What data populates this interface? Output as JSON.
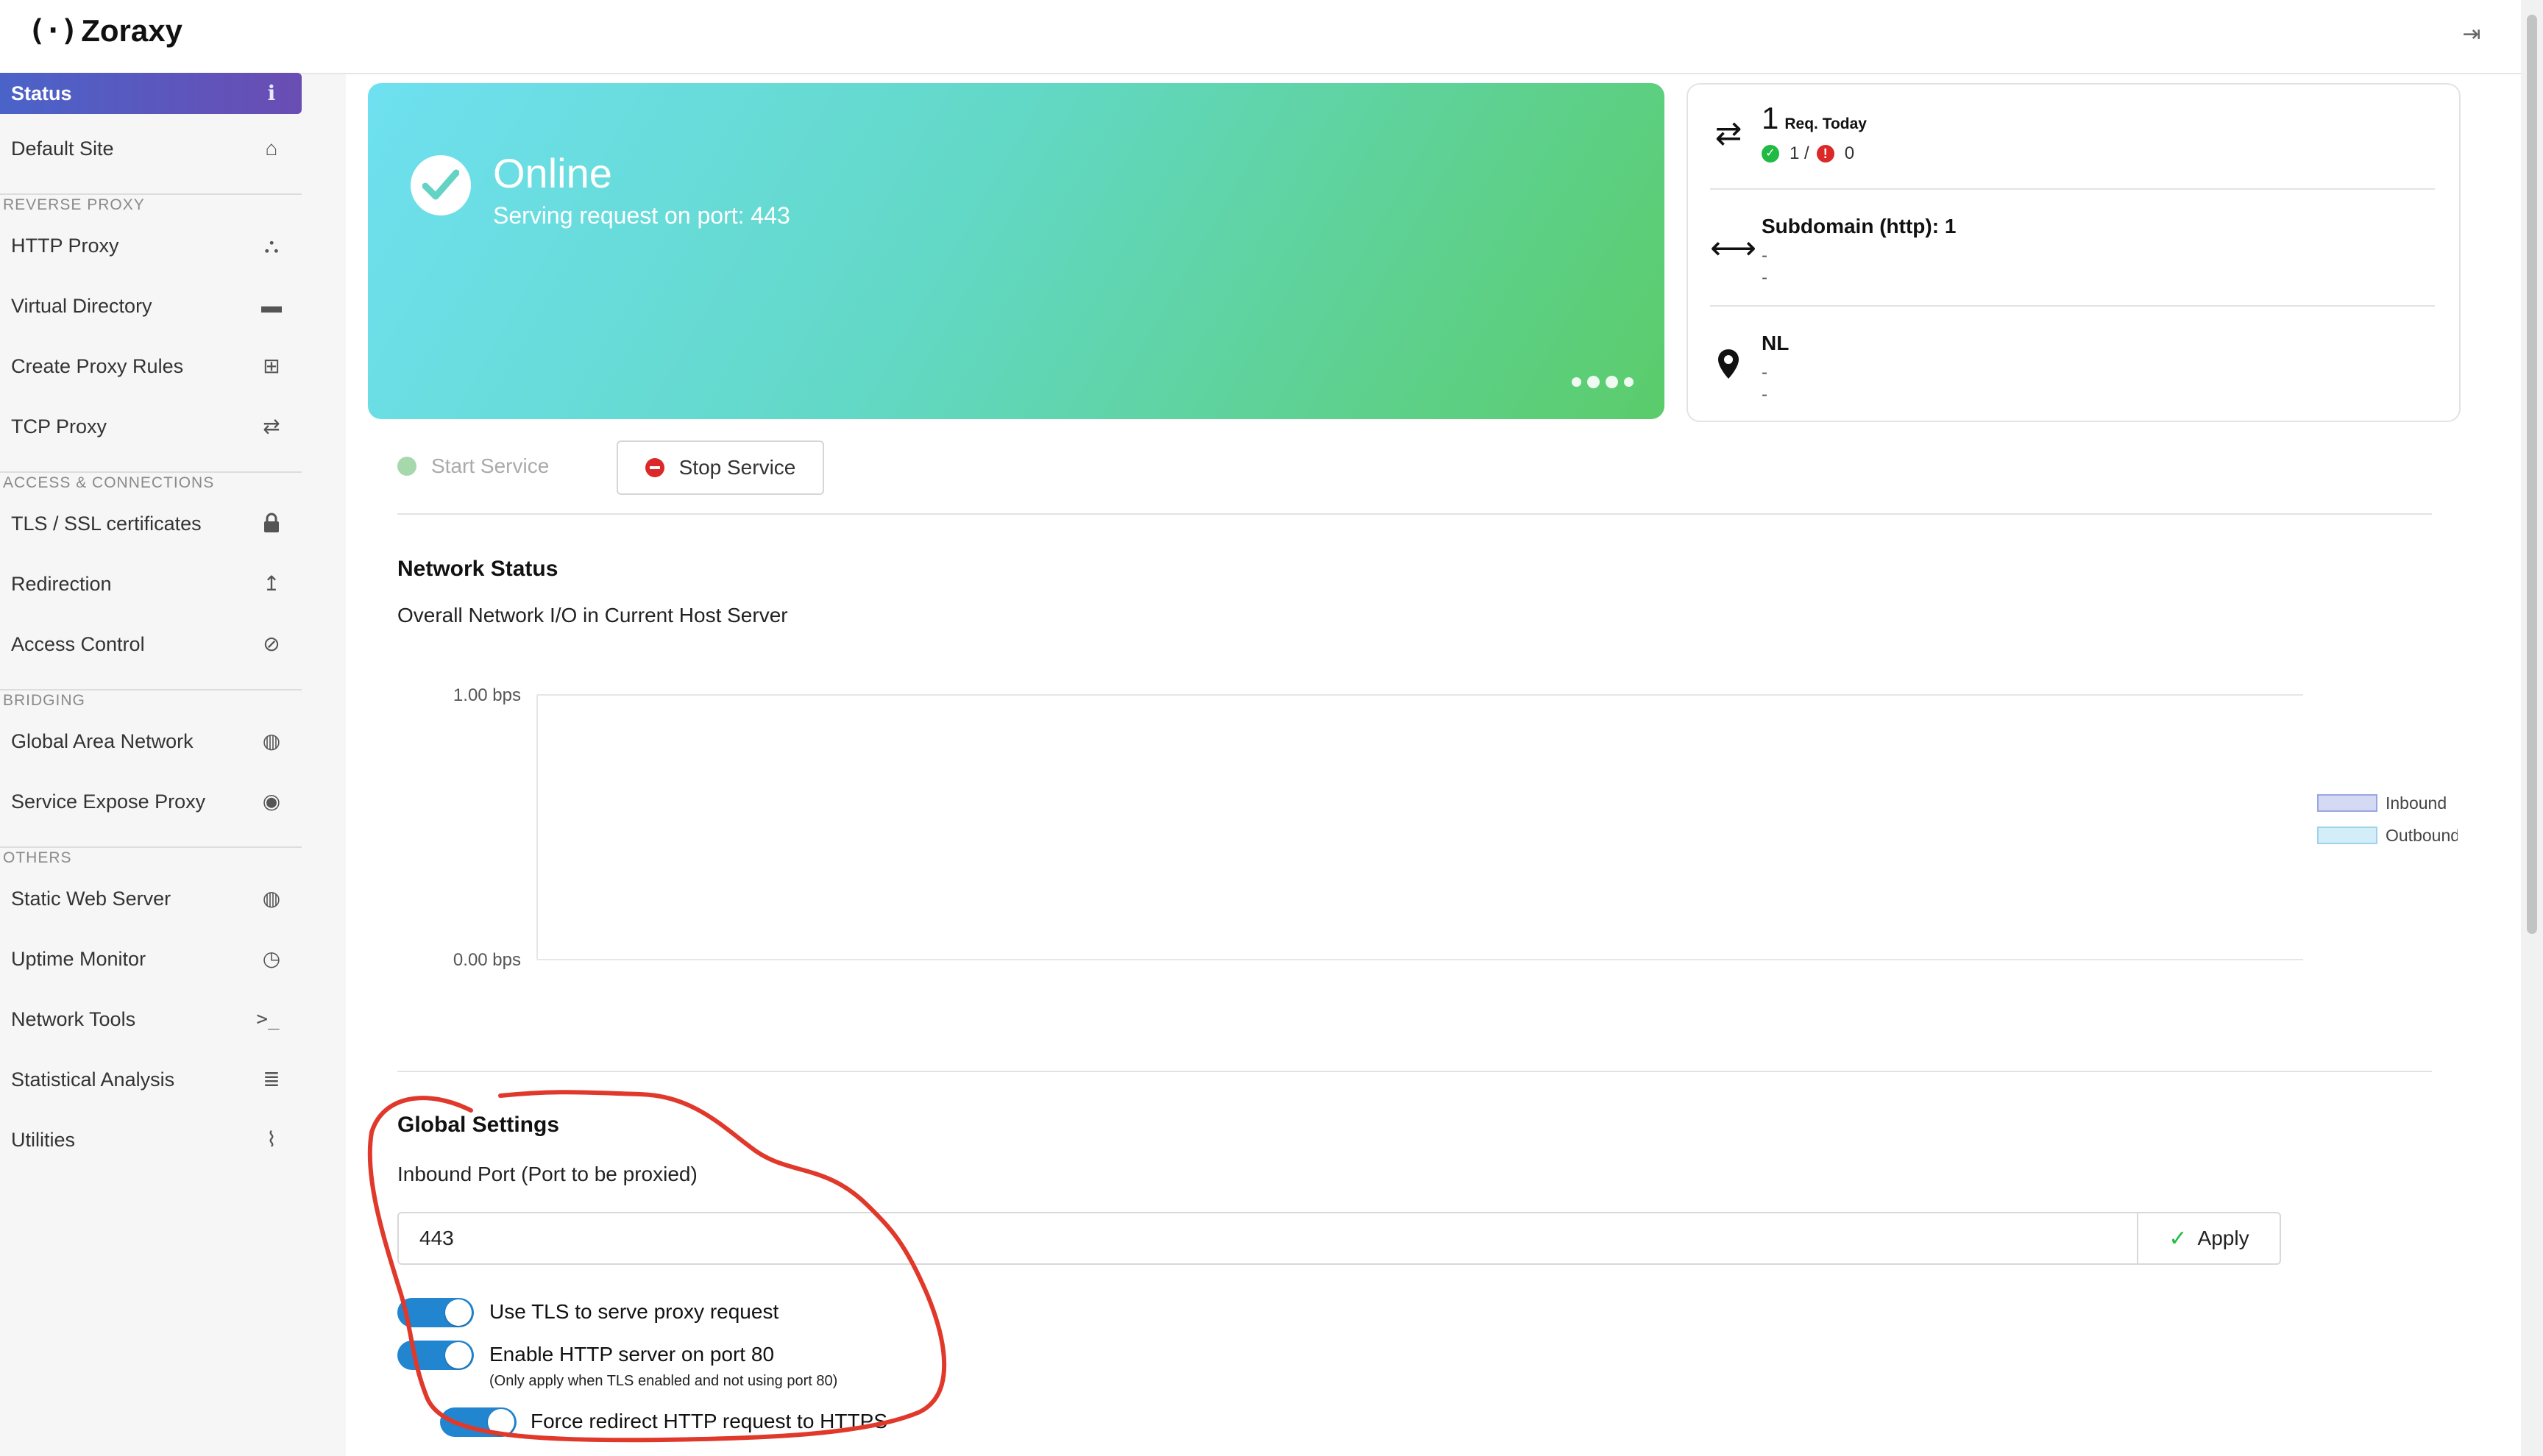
{
  "app": {
    "logo_mark": "(·)",
    "name": "Zoraxy"
  },
  "sidebar": {
    "items": [
      {
        "label": "Status",
        "icon": "info-circle-icon",
        "glyph": "ℹ"
      },
      {
        "label": "Default Site",
        "icon": "home-icon",
        "glyph": "⌂"
      },
      {
        "label": "HTTP Proxy",
        "icon": "sitemap-icon",
        "glyph": "⛬"
      },
      {
        "label": "Virtual Directory",
        "icon": "folder-icon",
        "glyph": "▬"
      },
      {
        "label": "Create Proxy Rules",
        "icon": "plus-square-icon",
        "glyph": "⊞"
      },
      {
        "label": "TCP Proxy",
        "icon": "exchange-icon",
        "glyph": "⇄"
      },
      {
        "label": "TLS / SSL certificates",
        "icon": "lock-icon",
        "glyph": "🔒"
      },
      {
        "label": "Redirection",
        "icon": "level-up-icon",
        "glyph": "↥"
      },
      {
        "label": "Access Control",
        "icon": "ban-icon",
        "glyph": "⊘"
      },
      {
        "label": "Global Area Network",
        "icon": "globe-icon",
        "glyph": "◍"
      },
      {
        "label": "Service Expose Proxy",
        "icon": "podcast-icon",
        "glyph": "◉"
      },
      {
        "label": "Static Web Server",
        "icon": "globe-icon",
        "glyph": "◍"
      },
      {
        "label": "Uptime Monitor",
        "icon": "clock-icon",
        "glyph": "◷"
      },
      {
        "label": "Network Tools",
        "icon": "terminal-icon",
        "glyph": ">_"
      },
      {
        "label": "Statistical Analysis",
        "icon": "database-icon",
        "glyph": "≣"
      },
      {
        "label": "Utilities",
        "icon": "paperclip-icon",
        "glyph": "⌇"
      }
    ],
    "sections": {
      "reverse_proxy": "REVERSE PROXY",
      "access": "ACCESS & CONNECTIONS",
      "bridging": "BRIDGING",
      "others": "OTHERS"
    }
  },
  "status_card": {
    "title": "Online",
    "subtitle": "Serving request on port: 443"
  },
  "stats": {
    "req_count": "1",
    "req_label": "Req. Today",
    "success": "1 /",
    "errors": "0",
    "subdomain_title": "Subdomain (http): 1",
    "subdomain_line1": "-",
    "subdomain_line2": "-",
    "location_title": "NL",
    "location_line1": "-",
    "location_line2": "-"
  },
  "service": {
    "start_label": "Start Service",
    "stop_label": "Stop Service"
  },
  "network": {
    "title": "Network Status",
    "subtitle": "Overall Network I/O in Current Host Server"
  },
  "chart_data": {
    "type": "line",
    "title": "",
    "xlabel": "",
    "ylabel": "",
    "y_tick_labels": [
      "1.00 bps",
      "0.00 bps"
    ],
    "ylim": [
      0,
      1
    ],
    "series": [
      {
        "name": "Inbound",
        "values": [],
        "color": "#d4d9f4"
      },
      {
        "name": "Outbound",
        "values": [],
        "color": "#d3eef8"
      }
    ],
    "legend_position": "right"
  },
  "global_settings": {
    "title": "Global Settings",
    "port_label": "Inbound Port (Port to be proxied)",
    "port_value": "443",
    "apply_label": "Apply",
    "tls_label": "Use TLS to serve proxy request",
    "tls_enabled": true,
    "http80_label": "Enable HTTP server on port 80",
    "http80_note": "(Only apply when TLS enabled and not using port 80)",
    "http80_enabled": true,
    "redirect_label": "Force redirect HTTP request to HTTPS",
    "redirect_enabled": true
  },
  "colors": {
    "accent": "#2185d0",
    "status_gradient_start": "#6ee0f0",
    "status_gradient_end": "#5bcc6a",
    "annotation": "#e0392b"
  }
}
